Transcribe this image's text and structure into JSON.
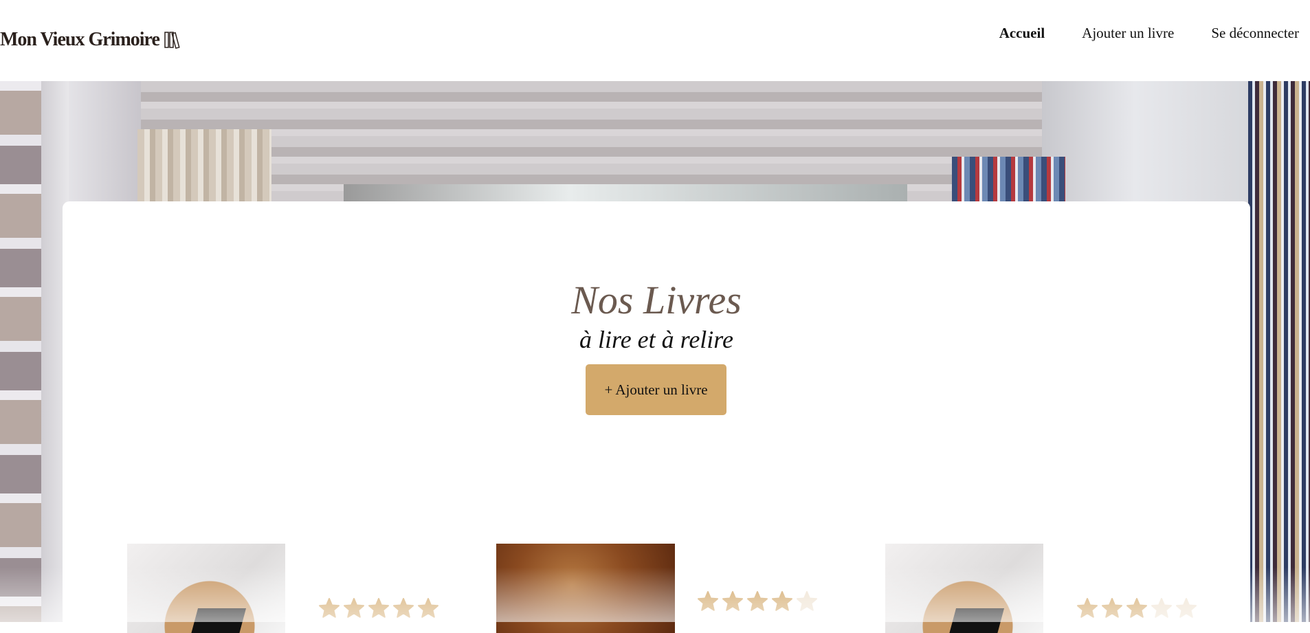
{
  "header": {
    "logo_text": "Mon Vieux Grimoire",
    "logo_icon": "books-icon",
    "nav": [
      {
        "label": "Accueil",
        "active": true
      },
      {
        "label": "Ajouter un livre",
        "active": false
      },
      {
        "label": "Se déconnecter",
        "active": false
      }
    ]
  },
  "main": {
    "title": "Nos Livres",
    "subtitle": "à lire et à relire",
    "add_button": "+ Ajouter un livre"
  },
  "books": [
    {
      "rating": 5,
      "max": 5
    },
    {
      "rating": 4,
      "max": 5
    },
    {
      "rating": 3,
      "max": 5
    }
  ],
  "colors": {
    "accent": "#d3a96b",
    "title": "#6b5a50",
    "star_filled": "#d3a96b",
    "star_empty": "#efe3d2"
  }
}
